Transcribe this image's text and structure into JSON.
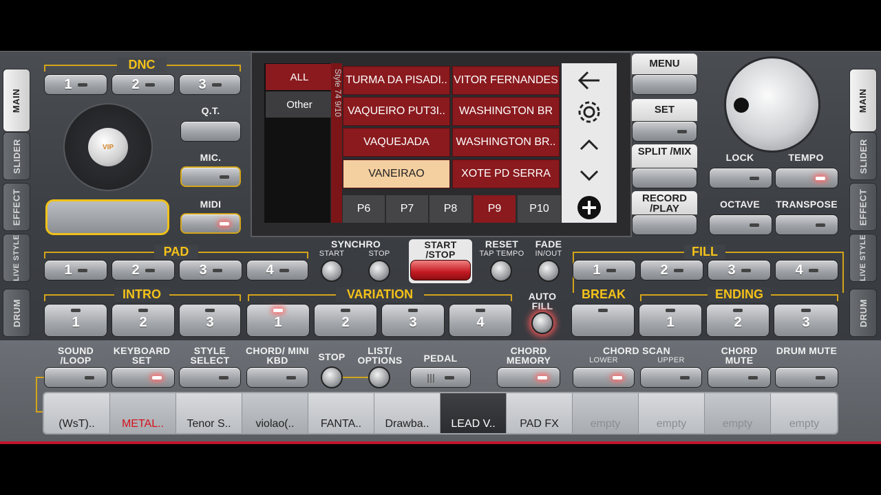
{
  "side_tabs_left": [
    "MAIN",
    "SLIDER",
    "EFFECT",
    "LIVE STYLE",
    "DRUM"
  ],
  "side_tabs_right": [
    "MAIN",
    "SLIDER",
    "EFFECT",
    "LIVE STYLE",
    "DRUM"
  ],
  "dnc": {
    "title": "DNC",
    "buttons": [
      "1",
      "2",
      "3"
    ]
  },
  "qt": "Q.T.",
  "mic": "MIC.",
  "midi": "MIDI",
  "vip_logo": "VIP",
  "browser": {
    "categories": [
      "ALL",
      "Other"
    ],
    "style_count": "Style 74 9/10",
    "styles": [
      "TURMA DA PISADI..",
      "VITOR FERNANDES",
      "VAQUEIRO PUT3I..",
      "WASHINGTON BR",
      "VAQUEJADA",
      "WASHINGTON BR..",
      "VANEIRAO",
      "XOTE PD SERRA"
    ],
    "pages": [
      "P6",
      "P7",
      "P8",
      "P9",
      "P10"
    ],
    "nav_icons": [
      "back-arrow-icon",
      "gear-icon",
      "chevron-up-icon",
      "chevron-down-icon",
      "plus-icon"
    ]
  },
  "right_menu": {
    "menu": "MENU",
    "set": "SET",
    "split": "SPLIT /MIX",
    "record": "RECORD /PLAY"
  },
  "lock": "LOCK",
  "tempo": "TEMPO",
  "octave": "OCTAVE",
  "transpose": "TRANSPOSE",
  "pad": {
    "title": "PAD",
    "buttons": [
      "1",
      "2",
      "3",
      "4"
    ]
  },
  "synchro": {
    "title": "SYNCHRO",
    "start": "START",
    "stop": "STOP"
  },
  "start_stop": "START /STOP",
  "reset": {
    "title": "RESET",
    "sub": "TAP TEMPO"
  },
  "fade": {
    "title": "FADE",
    "sub": "IN/OUT"
  },
  "fill": {
    "title": "FILL",
    "buttons": [
      "1",
      "2",
      "3",
      "4"
    ]
  },
  "intro": {
    "title": "INTRO",
    "buttons": [
      "1",
      "2",
      "3"
    ]
  },
  "variation": {
    "title": "VARIATION",
    "buttons": [
      "1",
      "2",
      "3",
      "4"
    ]
  },
  "auto_fill": "AUTO FILL",
  "break": "BREAK",
  "ending": {
    "title": "ENDING",
    "buttons": [
      "1",
      "2",
      "3"
    ]
  },
  "lower_labels": {
    "sound_loop": "SOUND /LOOP",
    "keyboard_set": "KEYBOARD SET",
    "style_select": "STYLE SELECT",
    "chord_mini": "CHORD/ MINI KBD",
    "stop": "STOP",
    "list_options": "LIST/ OPTIONS",
    "pedal": "PEDAL",
    "chord_memory": "CHORD MEMORY",
    "chord_scan": "CHORD SCAN",
    "lower": "LOWER",
    "upper": "UPPER",
    "chord_mute": "CHORD MUTE",
    "drum_mute": "DRUM MUTE",
    "pedal_glyph": "|||"
  },
  "sounds": [
    "(WsT)..",
    "METAL..",
    "Tenor S..",
    "violao(..",
    "FANTA..",
    "Drawba..",
    "LEAD V..",
    "PAD FX",
    "empty",
    "empty",
    "empty",
    "empty"
  ],
  "colors": {
    "accent_gold": "#f4c21a",
    "style_red": "#8a1a1e",
    "selected_style": "#f4cfa0",
    "led_red": "#ff5a5a"
  }
}
